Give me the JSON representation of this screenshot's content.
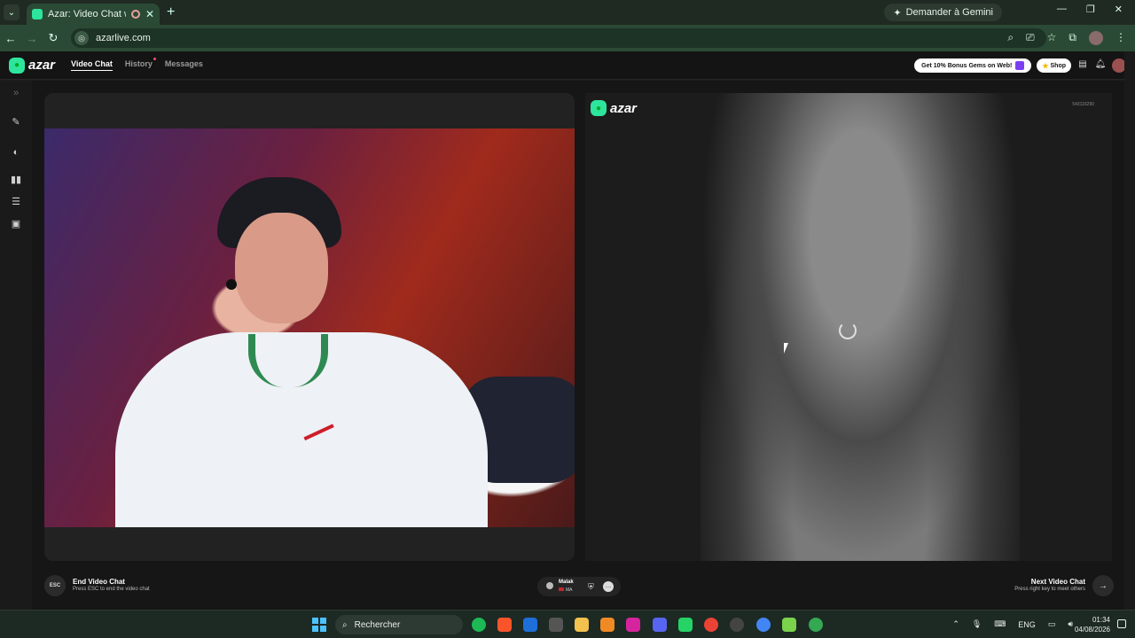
{
  "browser": {
    "tab_title": "Azar: Video Chat with New",
    "url": "azarlive.com",
    "gemini_label": "Demander à Gemini"
  },
  "app": {
    "logo_text": "azar",
    "nav": {
      "video_chat": "Video Chat",
      "history": "History",
      "messages": "Messages"
    },
    "promo_label": "Get 10% Bonus Gems on Web!",
    "shop_label": "Shop",
    "accent_color": "#2ee59d"
  },
  "peer": {
    "logo_text": "azar",
    "id_text": "543116290",
    "name": "Malak",
    "country": "MA"
  },
  "controls": {
    "esc_key": "ESC",
    "end_title": "End Video Chat",
    "end_sub": "Press ESC to end the video chat",
    "next_title": "Next Video Chat",
    "next_sub": "Press right key to meet others"
  },
  "taskbar": {
    "search_placeholder": "Rechercher",
    "lang": "ENG",
    "time": "01:34",
    "date": "04/08/2026"
  }
}
